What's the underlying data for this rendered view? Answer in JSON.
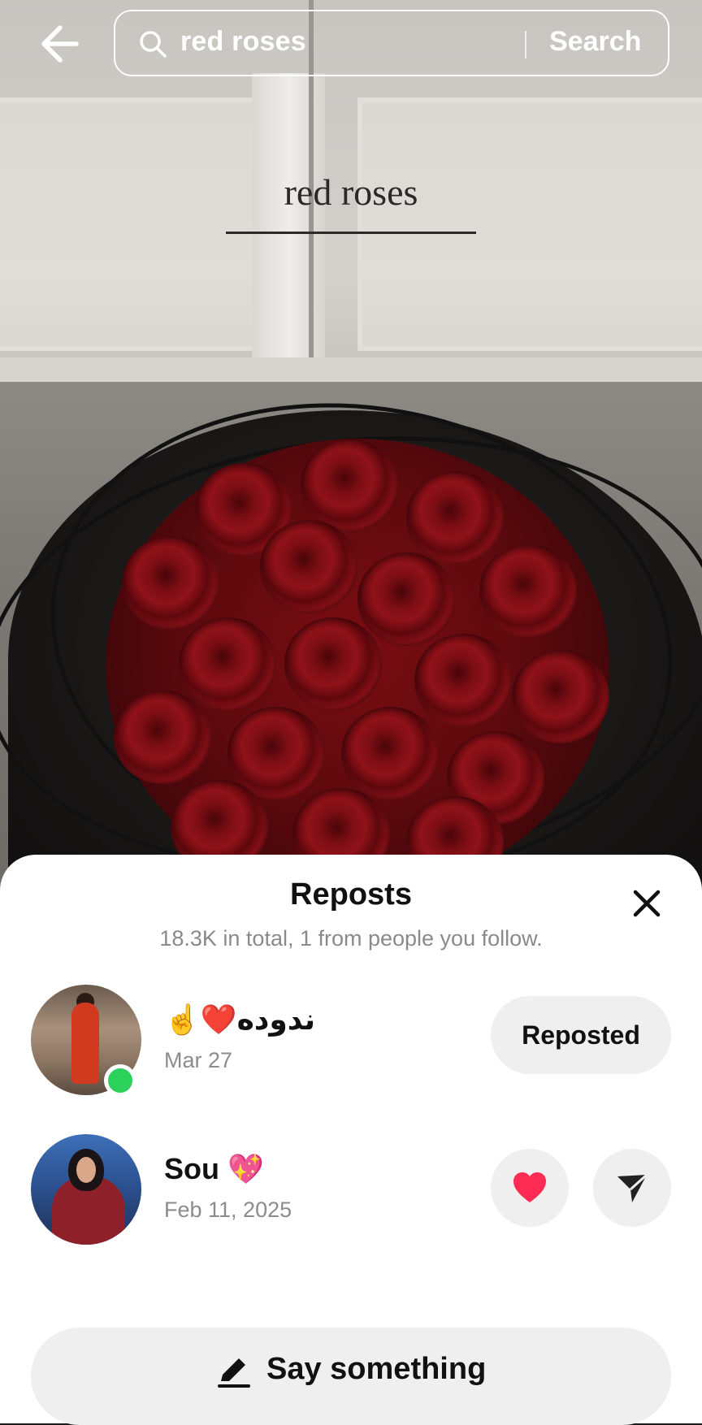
{
  "search": {
    "query": "red roses",
    "button_label": "Search"
  },
  "photo": {
    "caption": "red roses"
  },
  "reposts_sheet": {
    "title": "Reposts",
    "subtitle": "18.3K in total, 1 from people you follow.",
    "users": [
      {
        "name": "☝️❤️ندوده",
        "date": "Mar 27",
        "action_label": "Reposted",
        "online": true
      },
      {
        "name": "Sou 💖",
        "date": "Feb 11, 2025"
      }
    ],
    "comment_button_label": "Say something"
  },
  "colors": {
    "online": "#2bd15b",
    "heart": "#fe2c55"
  },
  "icons": {
    "back": "arrow-left-icon",
    "search": "search-icon",
    "close": "close-icon",
    "heart": "heart-icon",
    "send": "send-icon",
    "pencil": "pencil-icon"
  }
}
